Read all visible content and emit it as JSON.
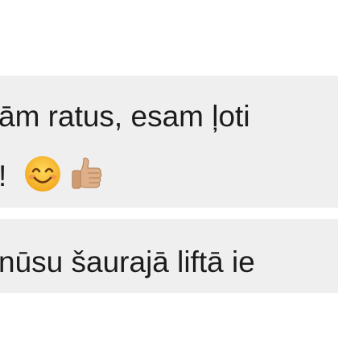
{
  "messages": [
    {
      "line1": "ām ratus, esam ļoti",
      "line2": "!",
      "emojis": [
        "smiling-face-icon",
        "thumbs-up-icon"
      ]
    },
    {
      "line1": "nūsu šaurajā liftā ie"
    }
  ],
  "colors": {
    "bubble_bg": "#efefef",
    "text": "#1c1c1c",
    "emoji_face": "#f5b52e",
    "emoji_thumb": "#d9a77e"
  }
}
